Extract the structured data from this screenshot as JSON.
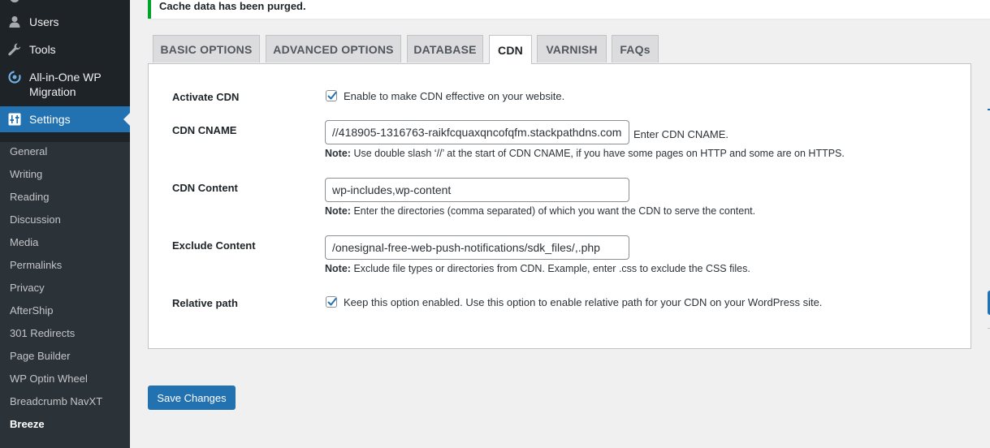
{
  "sidebar": {
    "menu": [
      {
        "key": "users",
        "label": "Users",
        "icon": "users-icon"
      },
      {
        "key": "tools",
        "label": "Tools",
        "icon": "wrench-icon"
      },
      {
        "key": "aio",
        "label": "All-in-One WP Migration",
        "icon": "migration-icon"
      },
      {
        "key": "settings",
        "label": "Settings",
        "icon": "settings-icon"
      }
    ],
    "submenu": [
      "General",
      "Writing",
      "Reading",
      "Discussion",
      "Media",
      "Permalinks",
      "Privacy",
      "AfterShip",
      "301 Redirects",
      "Page Builder",
      "WP Optin Wheel",
      "Breadcrumb NavXT",
      "Breeze"
    ],
    "current_submenu": "Breeze"
  },
  "notice": {
    "text": "Cache data has been purged."
  },
  "tabs": [
    {
      "label": "BASIC OPTIONS",
      "active": false
    },
    {
      "label": "ADVANCED OPTIONS",
      "active": false
    },
    {
      "label": "DATABASE",
      "active": false
    },
    {
      "label": "CDN",
      "active": true
    },
    {
      "label": "VARNISH",
      "active": false
    },
    {
      "label": "FAQs",
      "active": false
    }
  ],
  "cdn": {
    "activate": {
      "label": "Activate CDN",
      "checked": true,
      "text": "Enable to make CDN effective on your website."
    },
    "cname": {
      "label": "CDN CNAME",
      "value": "//418905-1316763-raikfcquaxqncofqfm.stackpathdns.com",
      "hint": "Enter CDN CNAME.",
      "note_prefix": "Note:",
      "note": "Use double slash ‘//’ at the start of CDN CNAME, if you have some pages on HTTP and some are on HTTPS."
    },
    "content": {
      "label": "CDN Content",
      "value": "wp-includes,wp-content",
      "note_prefix": "Note:",
      "note": "Enter the directories (comma separated) of which you want the CDN to serve the content."
    },
    "exclude": {
      "label": "Exclude Content",
      "value": "/onesignal-free-web-push-notifications/sdk_files/,.php",
      "note_prefix": "Note:",
      "note": "Exclude file types or directories from CDN. Example, enter .css to exclude the CSS files."
    },
    "relative": {
      "label": "Relative path",
      "checked": true,
      "text": "Keep this option enabled. Use this option to enable relative path for your CDN on your WordPress site."
    }
  },
  "save_button": "Save Changes",
  "colors": {
    "admin_blue": "#2271b1",
    "sidebar_bg": "#1d2327",
    "notice_green": "#00a32a"
  }
}
